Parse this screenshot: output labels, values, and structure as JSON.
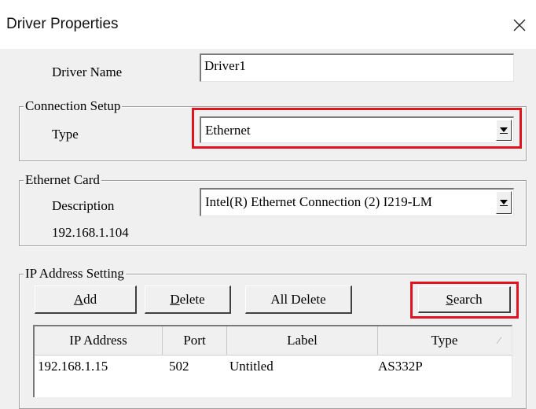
{
  "window": {
    "title": "Driver Properties",
    "close_icon": "close-icon"
  },
  "driver": {
    "name_label": "Driver Name",
    "name_value": "Driver1"
  },
  "connection": {
    "group_label": "Connection Setup",
    "type_label": "Type",
    "type_value": "Ethernet"
  },
  "ethernet_card": {
    "group_label": "Ethernet Card",
    "description_label": "Description",
    "description_value": "Intel(R) Ethernet Connection (2) I219-LM",
    "ip": "192.168.1.104"
  },
  "ip_setting": {
    "group_label": "IP Address Setting",
    "buttons": {
      "add": {
        "accel": "A",
        "rest": "dd"
      },
      "delete": {
        "accel": "D",
        "rest": "elete"
      },
      "all_delete": "All Delete",
      "search": {
        "accel": "S",
        "rest": "earch"
      }
    },
    "columns": [
      "IP Address",
      "Port",
      "Label",
      "Type"
    ],
    "rows": [
      {
        "ip": "192.168.1.15",
        "port": "502",
        "label": "Untitled",
        "type": "AS332P"
      }
    ]
  },
  "colors": {
    "highlight": "#e0141e",
    "dialog_bg": "#f0f0f0"
  }
}
